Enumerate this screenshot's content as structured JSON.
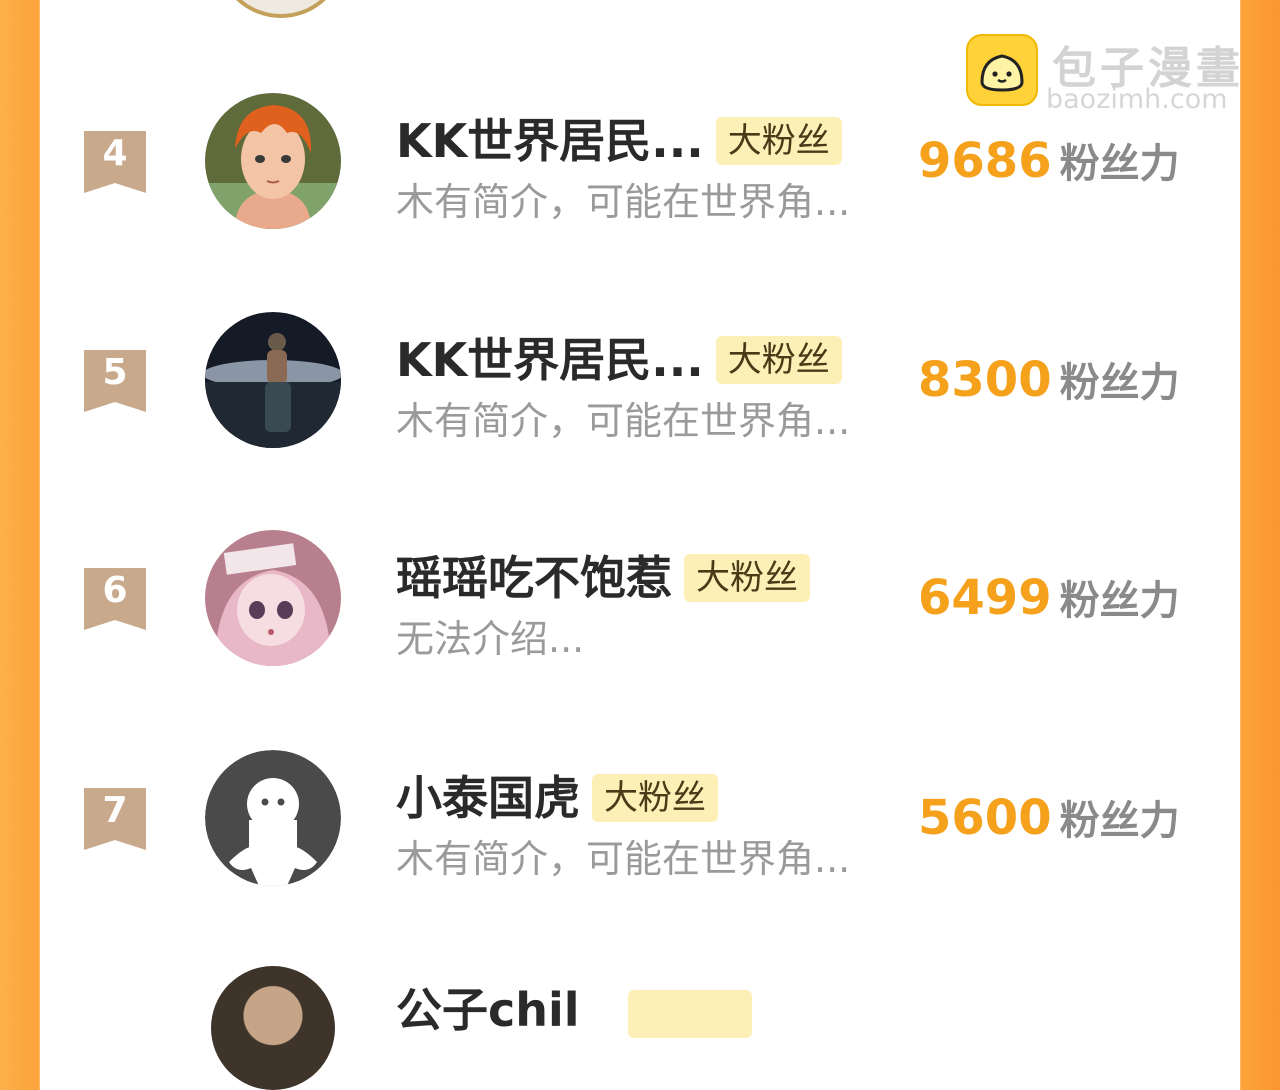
{
  "watermark": {
    "name_cn": "包子漫畫",
    "url": "baozimh.com"
  },
  "score_unit": "粉丝力",
  "rows": [
    {
      "rank": "4",
      "name": "KK世界居民...",
      "tag": "大粉丝",
      "bio": "木有简介，可能在世界角...",
      "score": "9686",
      "avatar_icon": "anime-boy-orange-hair-avatar"
    },
    {
      "rank": "5",
      "name": "KK世界居民...",
      "tag": "大粉丝",
      "bio": "木有简介，可能在世界角...",
      "score": "8300",
      "avatar_icon": "dark-photo-avatar"
    },
    {
      "rank": "6",
      "name": "瑶瑶吃不饱惹",
      "tag": "大粉丝",
      "bio": "无法介绍...",
      "score": "6499",
      "avatar_icon": "anime-girl-pink-avatar"
    },
    {
      "rank": "7",
      "name": "小泰国虎",
      "tag": "大粉丝",
      "bio": "木有简介，可能在世界角...",
      "score": "5600",
      "avatar_icon": "default-ghost-avatar"
    }
  ],
  "partial_row": {
    "name": "公子chil"
  },
  "colors": {
    "accent_orange": "#f5a11c",
    "tag_bg": "#fdf0b6",
    "rank_badge": "#c9a98b",
    "side_orange": "#fda33a"
  }
}
